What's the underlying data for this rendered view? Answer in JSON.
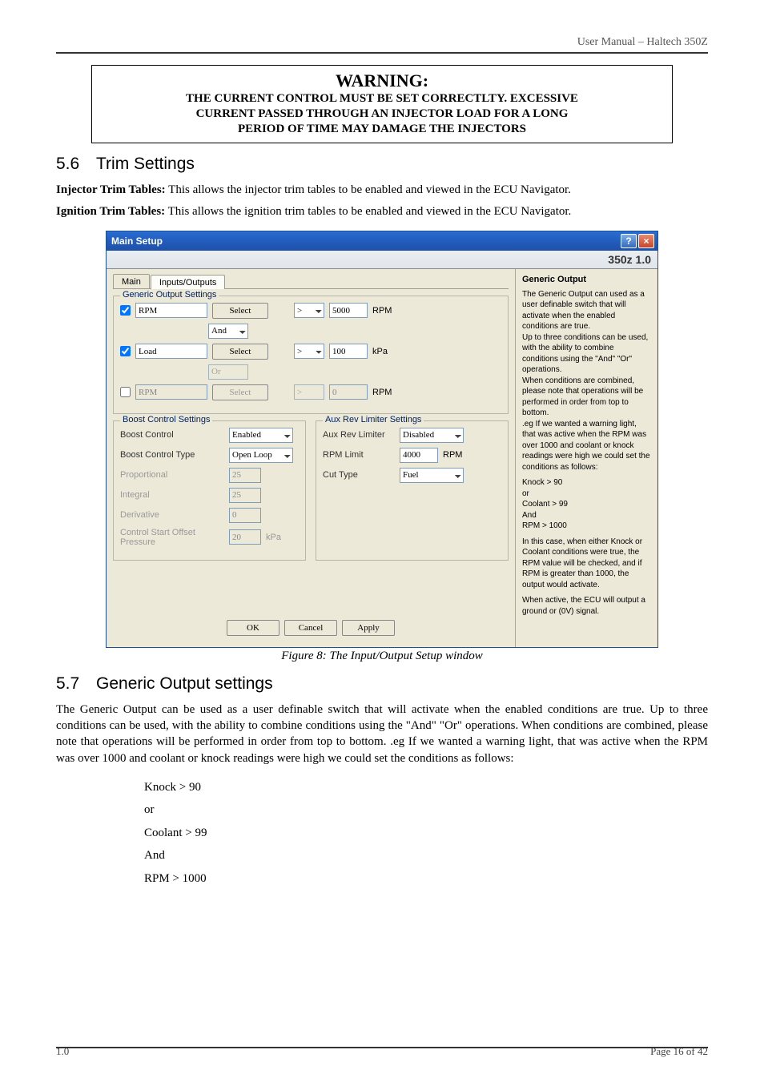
{
  "header": {
    "right": "User Manual – Haltech 350Z"
  },
  "warning": {
    "title": "WARNING:",
    "body_l1": "THE CURRENT CONTROL MUST BE SET CORRECTLTY.  EXCESSIVE",
    "body_l2": "CURRENT PASSED THROUGH AN INJECTOR LOAD FOR A LONG",
    "body_l3": "PERIOD OF TIME MAY DAMAGE THE INJECTORS"
  },
  "sec56": {
    "num": "5.6",
    "title": "Trim Settings",
    "p1_b": "Injector Trim Tables:",
    "p1": " This allows the injector trim tables to be enabled and viewed in the ECU Navigator.",
    "p2_b": "Ignition Trim Tables:",
    "p2": " This allows the ignition trim tables to be enabled and viewed in the ECU Navigator."
  },
  "dialog": {
    "title": "Main Setup",
    "help_glyph": "?",
    "close_glyph": "×",
    "banner": "350z 1.0",
    "tabs": {
      "main": "Main",
      "io": "Inputs/Outputs"
    },
    "gos": {
      "label": "Generic Output Settings",
      "rows": [
        {
          "checked": true,
          "name": "RPM",
          "select": "Select",
          "op": ">",
          "val": "5000",
          "unit": "RPM",
          "logic": "And",
          "enabled": true
        },
        {
          "checked": true,
          "name": "Load",
          "select": "Select",
          "op": ">",
          "val": "100",
          "unit": "kPa",
          "logic": "Or",
          "enabled": true
        },
        {
          "checked": false,
          "name": "RPM",
          "select": "Select",
          "op": ">",
          "val": "0",
          "unit": "RPM",
          "logic": "",
          "enabled": false
        }
      ]
    },
    "bcs": {
      "label": "Boost Control Settings",
      "boost_control_lbl": "Boost Control",
      "boost_control_val": "Enabled",
      "boost_type_lbl": "Boost Control Type",
      "boost_type_val": "Open Loop",
      "prop_lbl": "Proportional",
      "prop_val": "25",
      "int_lbl": "Integral",
      "int_val": "25",
      "der_lbl": "Derivative",
      "der_val": "0",
      "csop_lbl": "Control Start Offset Pressure",
      "csop_val": "20",
      "csop_unit": "kPa"
    },
    "arl": {
      "label": "Aux Rev Limiter Settings",
      "arl_lbl": "Aux Rev Limiter",
      "arl_val": "Disabled",
      "rpm_lbl": "RPM Limit",
      "rpm_val": "4000",
      "rpm_unit": "RPM",
      "cut_lbl": "Cut Type",
      "cut_val": "Fuel"
    },
    "buttons": {
      "ok": "OK",
      "cancel": "Cancel",
      "apply": "Apply"
    },
    "help": {
      "hdr": "Generic Output",
      "p1": "The Generic Output can used as a user definable switch that will activate when the enabled conditions are true.",
      "p2": "Up to three conditions can be used, with the ability to combine conditions using the \"And\" \"Or\" operations.",
      "p3": "When conditions are combined, please note that operations will be performed in order from top to bottom.",
      "p4": ".eg If we wanted a warning light, that was active when the RPM was over 1000 and coolant or knock readings were high we could set the conditions as follows:",
      "c1": "Knock > 90",
      "c2": "or",
      "c3": "Coolant > 99",
      "c4": "And",
      "c5": "RPM > 1000",
      "p5": "In this case, when either Knock or Coolant conditions were true, the RPM value will be checked, and if RPM is greater than 1000, the output would activate.",
      "p6": "When active, the ECU will output a ground or (0V) signal."
    }
  },
  "figcap": "Figure 8: The Input/Output Setup window",
  "sec57": {
    "num": "5.7",
    "title": "Generic Output settings",
    "p1_a": "The Generic Output can be used as ",
    "p1_b": "a ",
    "p1_c": "user definable switch that will activate when the enabled conditions are true. Up to three conditions can be used, with the ability to combine conditions using the \"And\" \"Or\" operations. When conditions are combined, please note that operations will be performed in order from top to bottom. .eg If we wanted a warning light, that was active when the RPM was over 1000 and coolant or knock readings were high we could set the conditions as follows:",
    "c1": "Knock > 90",
    "c2": "or",
    "c3": "Coolant > 99",
    "c4": "And",
    "c5": "RPM > 1000"
  },
  "footer": {
    "left": "1.0",
    "right": "Page 16 of 42"
  }
}
